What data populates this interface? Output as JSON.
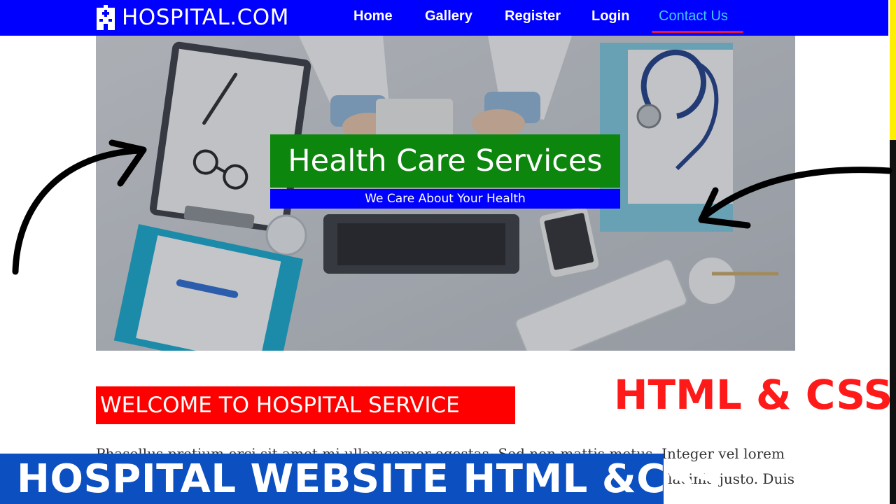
{
  "brand": {
    "name": "HOSPITAL.COM",
    "icon": "hospital-building-icon"
  },
  "nav": {
    "items": [
      "Home",
      "Gallery",
      "Register",
      "Login",
      "Contact Us"
    ],
    "active": "Contact Us"
  },
  "hero": {
    "title": "Health Care Services",
    "subtitle": "We Care About Your Health"
  },
  "welcome": {
    "heading": "WELCOME TO HOSPITAL SERVICE"
  },
  "thumbnail_label": "HTML & CSS",
  "paragraph": {
    "line1": "Phasellus pretium orci sit amet mi ullamcorper egestas. Sed non mattis metus. Integer vel lorem",
    "line2": "s lacinia justo. Duis"
  },
  "banner": {
    "text": "HOSPITAL WEBSITE HTML &CSS"
  },
  "colors": {
    "nav_bg": "#0000fe",
    "active_link": "#41c8ff",
    "underline": "#e8163f",
    "title_box": "#0c860c",
    "subtitle_box": "#0000fe",
    "welcome_box": "#ff0000",
    "tech_label": "#ff1a1a",
    "banner_bg": "#0b4fc0"
  }
}
